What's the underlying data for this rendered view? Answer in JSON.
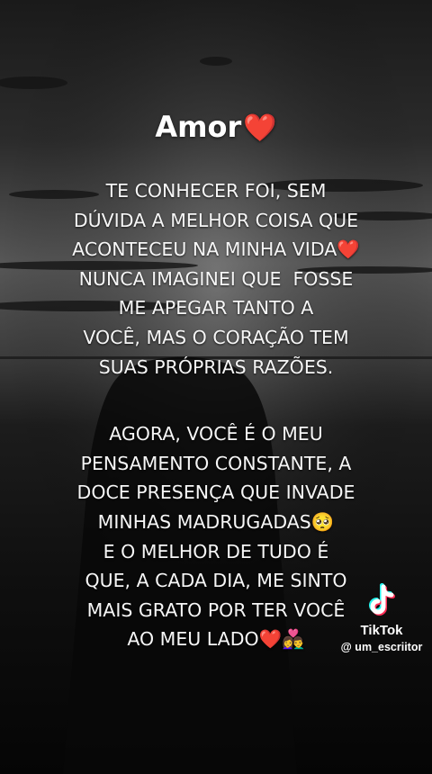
{
  "title": "Amor",
  "title_emoji": "❤️",
  "paragraph1": [
    "TE CONHECER FOI, SEM",
    "DÚVIDA A MELHOR COISA QUE",
    "ACONTECEU NA MINHA VIDA❤️",
    "NUNCA IMAGINEI QUE  FOSSE",
    "ME APEGAR TANTO A",
    "VOCÊ, MAS O CORAÇÃO TEM",
    "SUAS PRÓPRIAS RAZÕES."
  ],
  "paragraph2": [
    "AGORA, VOCÊ É O MEU",
    "PENSAMENTO CONSTANTE, A",
    "DOCE PRESENÇA QUE INVADE",
    "MINHAS MADRUGADAS🥺",
    "E O MELHOR DE TUDO É",
    "QUE, A CADA DIA, ME SINTO",
    "MAIS GRATO POR TER VOCÊ",
    "AO MEU LADO❤️👩‍❤️‍👨"
  ],
  "watermark": {
    "brand": "TikTok",
    "handle": "@ um_escriitor",
    "logo_icon": "tiktok-note-icon"
  },
  "colors": {
    "text": "#f6f6f6",
    "heart": "#e0191f",
    "tiktok_cyan": "#25f4ee",
    "tiktok_red": "#fe2c55"
  }
}
